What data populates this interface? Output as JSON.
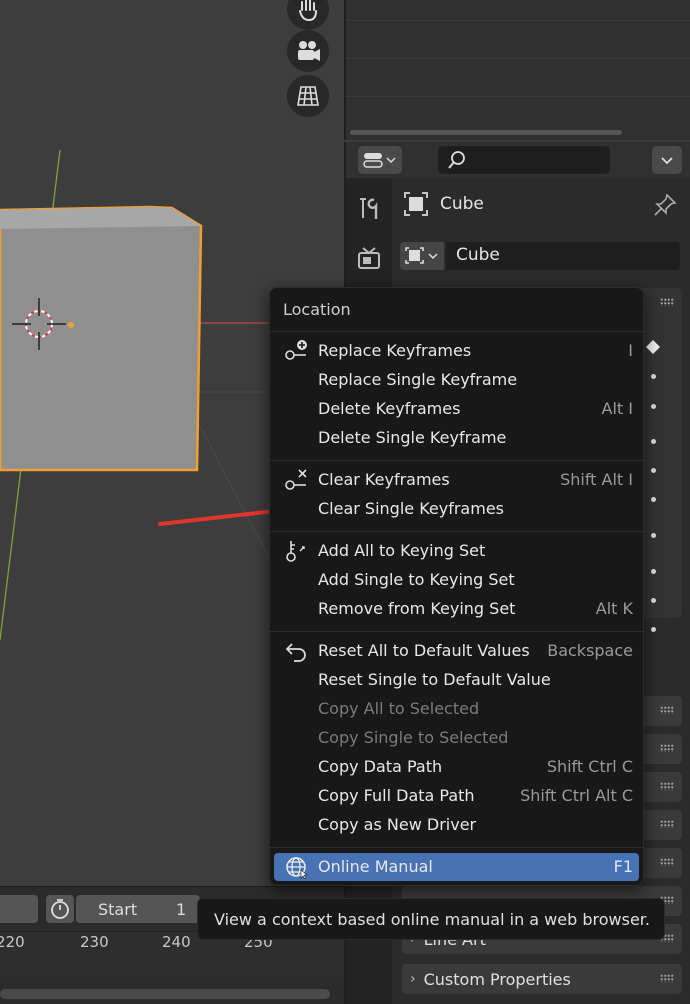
{
  "properties": {
    "object_name": "Cube",
    "object_field_value": "Cube",
    "search_placeholder": ""
  },
  "context_menu": {
    "title": "Location",
    "sections": [
      [
        {
          "label": "Replace Keyframes",
          "shortcut": "I",
          "icon": "keyframe-add-icon",
          "enabled": true
        },
        {
          "label": "Replace Single Keyframe",
          "shortcut": "",
          "icon": "",
          "enabled": true
        },
        {
          "label": "Delete Keyframes",
          "shortcut": "Alt I",
          "icon": "",
          "enabled": true
        },
        {
          "label": "Delete Single Keyframe",
          "shortcut": "",
          "icon": "",
          "enabled": true
        }
      ],
      [
        {
          "label": "Clear Keyframes",
          "shortcut": "Shift Alt I",
          "icon": "keyframe-clear-icon",
          "enabled": true
        },
        {
          "label": "Clear Single Keyframes",
          "shortcut": "",
          "icon": "",
          "enabled": true
        }
      ],
      [
        {
          "label": "Add All to Keying Set",
          "shortcut": "",
          "icon": "keying-set-icon",
          "enabled": true
        },
        {
          "label": "Add Single to Keying Set",
          "shortcut": "",
          "icon": "",
          "enabled": true
        },
        {
          "label": "Remove from Keying Set",
          "shortcut": "Alt K",
          "icon": "",
          "enabled": true
        }
      ],
      [
        {
          "label": "Reset All to Default Values",
          "shortcut": "Backspace",
          "icon": "reset-icon",
          "enabled": true
        },
        {
          "label": "Reset Single to Default Value",
          "shortcut": "",
          "icon": "",
          "enabled": true
        },
        {
          "label": "Copy All to Selected",
          "shortcut": "",
          "icon": "",
          "enabled": false
        },
        {
          "label": "Copy Single to Selected",
          "shortcut": "",
          "icon": "",
          "enabled": false
        },
        {
          "label": "Copy Data Path",
          "shortcut": "Shift Ctrl C",
          "icon": "",
          "enabled": true
        },
        {
          "label": "Copy Full Data Path",
          "shortcut": "Shift Ctrl Alt C",
          "icon": "",
          "enabled": true
        },
        {
          "label": "Copy as New Driver",
          "shortcut": "",
          "icon": "",
          "enabled": true
        }
      ],
      [
        {
          "label": "Online Manual",
          "shortcut": "F1",
          "icon": "globe-icon",
          "enabled": true,
          "highlighted": true
        }
      ]
    ]
  },
  "tooltip": "View a context based online manual in a web browser.",
  "timeline": {
    "start_label": "Start",
    "start_value": "1",
    "ticks": [
      "220",
      "230",
      "240",
      "250"
    ]
  },
  "panels": {
    "line_art": "Line Art",
    "custom_properties": "Custom Properties"
  },
  "colors": {
    "highlight": "#4772b3",
    "selection_outline": "#f0a030",
    "annotation_arrow": "#e0352b",
    "x_axis": "#c0474a",
    "y_axis": "#7aa53a"
  }
}
